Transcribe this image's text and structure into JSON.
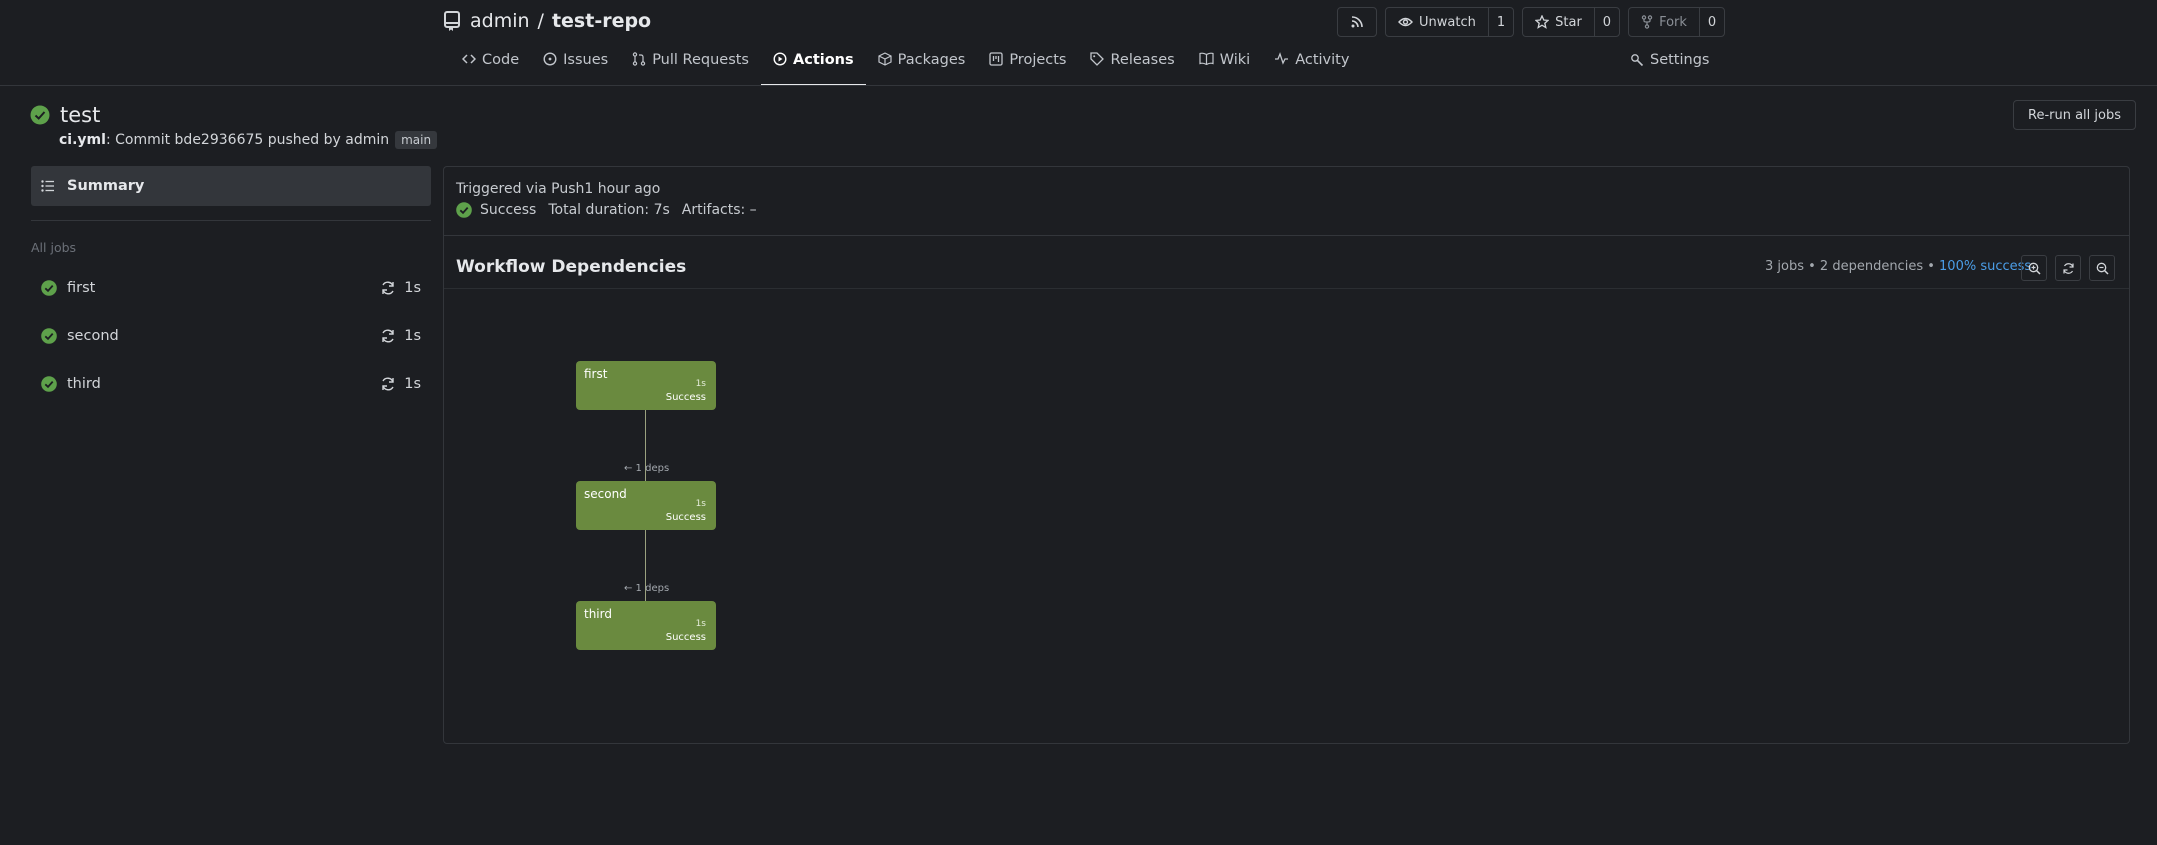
{
  "repo": {
    "owner": "admin",
    "separator": "/",
    "name": "test-repo"
  },
  "repo_actions": {
    "unwatch_label": "Unwatch",
    "unwatch_count": "1",
    "star_label": "Star",
    "star_count": "0",
    "fork_label": "Fork",
    "fork_count": "0"
  },
  "tabs": [
    {
      "label": "Code",
      "icon": "code-icon"
    },
    {
      "label": "Issues",
      "icon": "issue-icon"
    },
    {
      "label": "Pull Requests",
      "icon": "pull-request-icon"
    },
    {
      "label": "Actions",
      "icon": "play-icon",
      "active": true
    },
    {
      "label": "Packages",
      "icon": "package-icon"
    },
    {
      "label": "Projects",
      "icon": "project-icon"
    },
    {
      "label": "Releases",
      "icon": "tag-icon"
    },
    {
      "label": "Wiki",
      "icon": "book-icon"
    },
    {
      "label": "Activity",
      "icon": "pulse-icon"
    }
  ],
  "settings_label": "Settings",
  "run": {
    "title": "test",
    "workflow_file": "ci.yml",
    "meta_text": ": Commit bde2936675 pushed by admin",
    "branch": "main",
    "rerun_label": "Re-run all jobs"
  },
  "sidebar": {
    "summary_label": "Summary",
    "all_jobs_label": "All jobs",
    "jobs": [
      {
        "name": "first",
        "duration": "1s"
      },
      {
        "name": "second",
        "duration": "1s"
      },
      {
        "name": "third",
        "duration": "1s"
      }
    ]
  },
  "summary_panel": {
    "trigger_text": "Triggered via Push1 hour ago",
    "status": "Success",
    "total_duration": "Total duration: 7s",
    "artifacts": "Artifacts: –"
  },
  "workflow": {
    "title": "Workflow Dependencies",
    "stats_prefix": "3 jobs • 2 dependencies • ",
    "stats_success": "100% success",
    "nodes": [
      {
        "name": "first",
        "duration": "1s",
        "status": "Success"
      },
      {
        "name": "second",
        "duration": "1s",
        "status": "Success"
      },
      {
        "name": "third",
        "duration": "1s",
        "status": "Success"
      }
    ],
    "dep_labels": [
      "← 1 deps",
      "← 1 deps"
    ]
  },
  "colors": {
    "success_green": "#6a8a3f",
    "check_green": "#5ea14b",
    "link_blue": "#4b9ee8",
    "background": "#1c1e22"
  }
}
